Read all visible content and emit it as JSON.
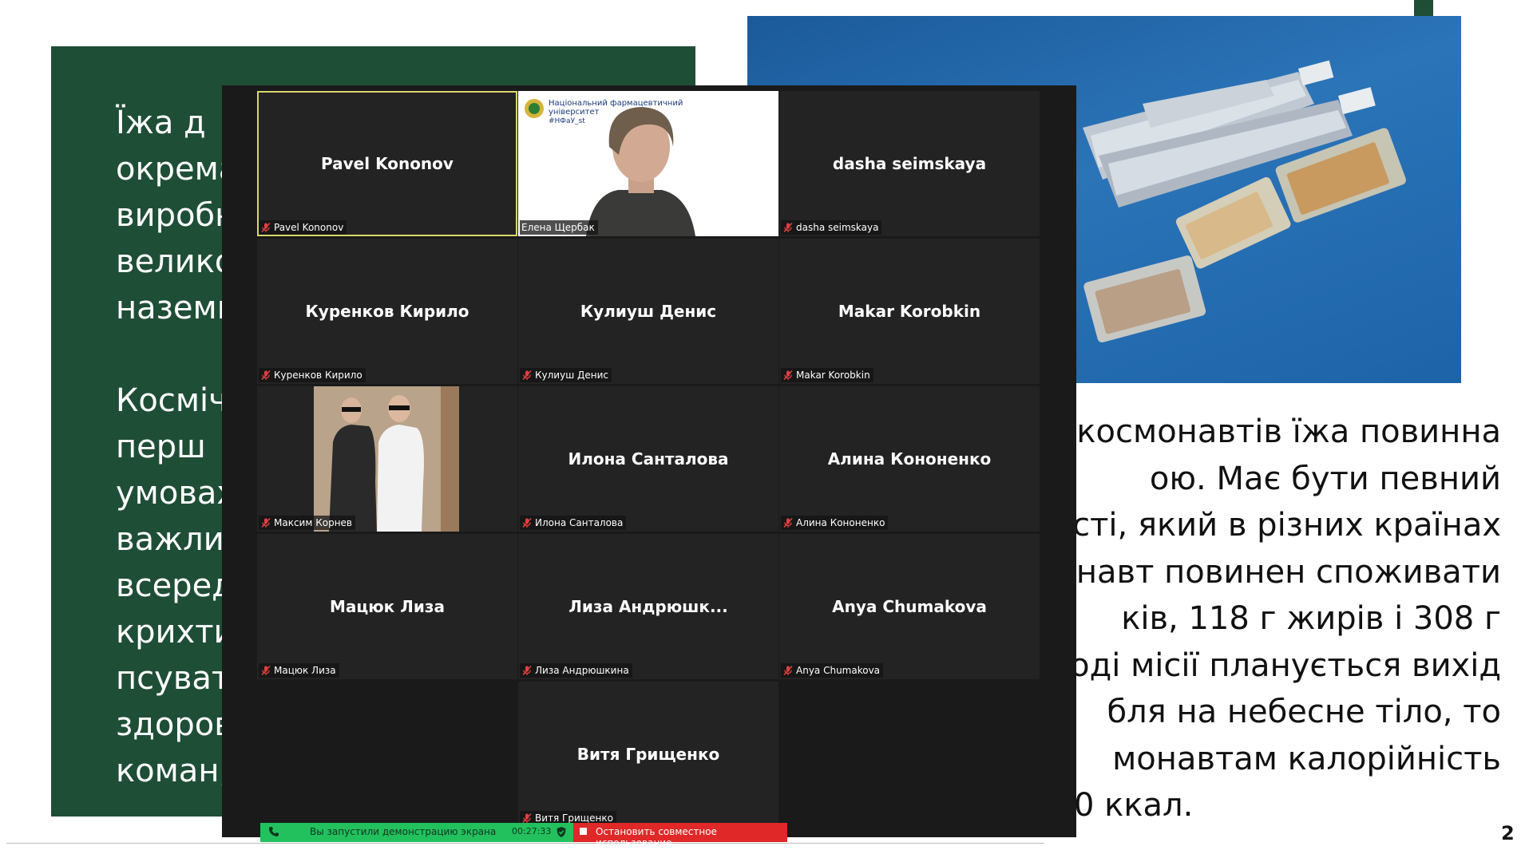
{
  "slide": {
    "left_text_lines": [
      "Їжа  д",
      "окрема",
      "виробн",
      "велико",
      "наземн",
      "",
      "Космічн",
      "перш",
      "умовах",
      "важли",
      "всеред",
      "крихти",
      "псуват",
      "здоров",
      "коман,"
    ],
    "right_text_lines": [
      "космонавтів їжа повинна",
      "ою.  Має  бути  певний",
      "сті, який в різних країнах",
      "онавт повинен споживати",
      "ків,  118  г  жирів  і  308  г",
      "ході місії планується вихід",
      "бля  на  небесне  тіло,  то",
      "монавтам     калорійність",
      "0 ккал."
    ],
    "page_number": "2",
    "accent_color": "#1f4e36"
  },
  "zoom": {
    "participants": [
      {
        "display": "Pavel Kononov",
        "label": "Pavel Kononov",
        "video": false,
        "active": true
      },
      {
        "display": "",
        "label": "Елена Щербак",
        "video": "presenter",
        "active": false,
        "logo_text_1": "Національний фармацевтичний",
        "logo_text_2": "університет",
        "logo_text_3": "#НФаУ_st"
      },
      {
        "display": "dasha seimskaya",
        "label": "dasha seimskaya",
        "video": false,
        "active": false
      },
      {
        "display": "Куренков Кирило",
        "label": "Куренков Кирило",
        "video": false,
        "active": false
      },
      {
        "display": "Кулиуш Денис",
        "label": "Кулиуш Денис",
        "video": false,
        "active": false
      },
      {
        "display": "Makar Korobkin",
        "label": "Makar Korobkin",
        "video": false,
        "active": false
      },
      {
        "display": "",
        "label": "Максим Корнев",
        "video": "selfie",
        "active": false
      },
      {
        "display": "Илона Санталова",
        "label": "Илона Санталова",
        "video": false,
        "active": false
      },
      {
        "display": "Алина Кононенко",
        "label": "Алина Кононенко",
        "video": false,
        "active": false
      },
      {
        "display": "Мацюк Лиза",
        "label": "Мацюк Лиза",
        "video": false,
        "active": false
      },
      {
        "display": "Лиза  Андрюшк...",
        "label": "Лиза Андрюшкина",
        "video": false,
        "active": false
      },
      {
        "display": "Anya Chumakova",
        "label": "Anya Chumakova",
        "video": false,
        "active": false
      },
      {
        "display": "",
        "label": "",
        "video": false,
        "active": false,
        "empty": true
      },
      {
        "display": "Витя Грищенко",
        "label": "Витя Грищенко",
        "video": false,
        "active": false
      },
      {
        "display": "",
        "label": "",
        "video": false,
        "active": false,
        "empty": true
      }
    ],
    "share_bar": {
      "message": "Вы запустили демонстрацию экрана",
      "timer": "00:27:33",
      "stop_label": "Остановить совместное использование",
      "green": "#22c15e",
      "red": "#e02828"
    },
    "icons": {
      "muted": "mic-muted-icon",
      "phone": "phone-icon",
      "shield": "shield-icon",
      "stop": "stop-square-icon"
    }
  }
}
